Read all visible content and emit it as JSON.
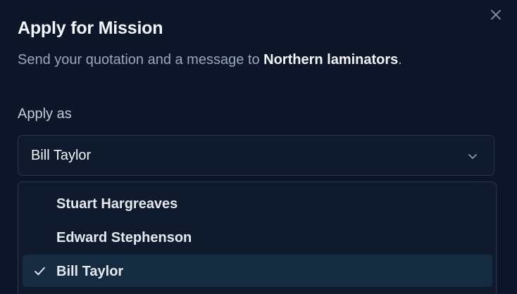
{
  "dialog": {
    "title": "Apply for Mission",
    "subtitle_prefix": "Send your quotation and a message to ",
    "subtitle_org": "Northern laminators",
    "subtitle_suffix": ".",
    "close_icon": "close-icon"
  },
  "apply_as": {
    "label": "Apply as",
    "selected_value": "Bill Taylor",
    "chevron_icon": "chevron-down-icon",
    "options": [
      {
        "label": "Stuart Hargreaves",
        "selected": false
      },
      {
        "label": "Edward Stephenson",
        "selected": false
      },
      {
        "label": "Bill Taylor",
        "selected": true
      }
    ],
    "check_icon": "check-icon"
  },
  "colors": {
    "background": "#0c1628",
    "text_primary": "#f2f5f9",
    "text_muted": "#9ba7bb",
    "border": "#2a3547",
    "selected_option_bg": "#142b40"
  }
}
